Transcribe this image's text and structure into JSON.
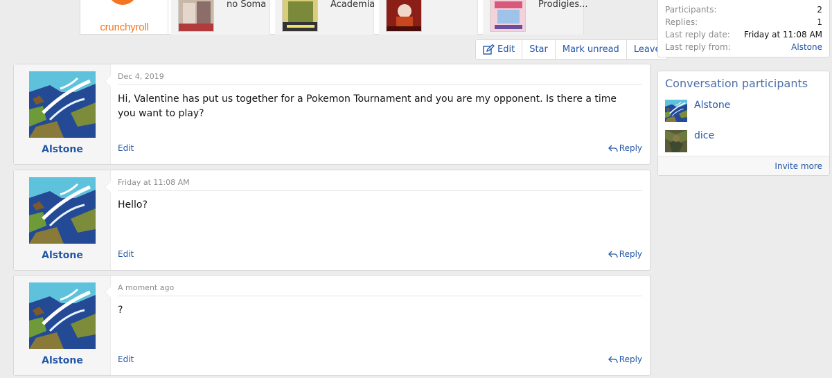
{
  "promo": {
    "brand": "crunchyroll",
    "items": [
      {
        "title": "no Soma"
      },
      {
        "title": "Academia"
      },
      {
        "title": ""
      },
      {
        "title": "Prodigies..."
      }
    ]
  },
  "actions": {
    "edit": "Edit",
    "star": "Star",
    "mark_unread": "Mark unread",
    "leave": "Leave"
  },
  "messages": [
    {
      "user": "Alstone",
      "date": "Dec 4, 2019",
      "body": "Hi, Valentine has put us together for a Pokemon Tournament and you are my opponent. Is there a time you want to play?",
      "edit": "Edit",
      "reply": "Reply"
    },
    {
      "user": "Alstone",
      "date": "Friday at 11:08 AM",
      "body": "Hello?",
      "edit": "Edit",
      "reply": "Reply"
    },
    {
      "user": "Alstone",
      "date": "A moment ago",
      "body": "?",
      "edit": "Edit",
      "reply": "Reply"
    }
  ],
  "info": {
    "participants_label": "Participants:",
    "participants_value": "2",
    "replies_label": "Replies:",
    "replies_value": "1",
    "last_date_label": "Last reply date:",
    "last_date_value": "Friday at 11:08 AM",
    "last_from_label": "Last reply from:",
    "last_from_value": "Alstone"
  },
  "participants": {
    "title": "Conversation participants",
    "list": [
      {
        "name": "Alstone"
      },
      {
        "name": "dice"
      }
    ],
    "invite": "Invite more"
  },
  "colors": {
    "link": "#2457a6",
    "brand_orange": "#f47521",
    "page_bg": "#ececec"
  }
}
